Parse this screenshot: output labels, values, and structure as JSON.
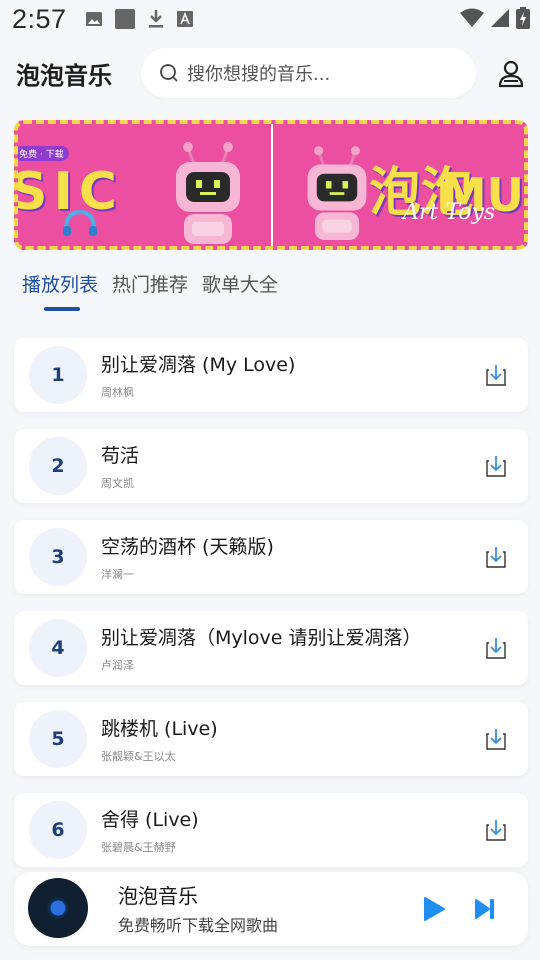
{
  "status_bar": {
    "time": "2:57"
  },
  "header": {
    "app_title": "泡泡音乐",
    "search_placeholder": "搜你想搜的音乐..."
  },
  "banner": {
    "left_text": "SIC",
    "left_tag": "免费 · 下载",
    "right_text": "泡泡",
    "right_tail": "MU",
    "right_subtitle": "Art Toys"
  },
  "tabs": [
    {
      "label": "播放列表",
      "active": true
    },
    {
      "label": "热门推荐",
      "active": false
    },
    {
      "label": "歌单大全",
      "active": false
    }
  ],
  "songs": [
    {
      "num": "1",
      "title": "别让爱凋落 (My Love)",
      "artist": "周林枫"
    },
    {
      "num": "2",
      "title": "苟活",
      "artist": "周文凯"
    },
    {
      "num": "3",
      "title": "空荡的酒杯 (天籁版)",
      "artist": "洋澜一"
    },
    {
      "num": "4",
      "title": "别让爱凋落（Mylove 请别让爱凋落）",
      "artist": "卢润泽"
    },
    {
      "num": "5",
      "title": "跳楼机 (Live)",
      "artist": "张靓颖&王以太"
    },
    {
      "num": "6",
      "title": "舍得 (Live)",
      "artist": "张碧晨&王赫野"
    }
  ],
  "player": {
    "title": "泡泡音乐",
    "subtitle": "免费畅听下载全网歌曲"
  },
  "colors": {
    "accent": "#1f4fa3",
    "play_button": "#1e8ff0",
    "banner_pink": "#ec4fa0",
    "banner_yellow": "#f7e04a"
  }
}
